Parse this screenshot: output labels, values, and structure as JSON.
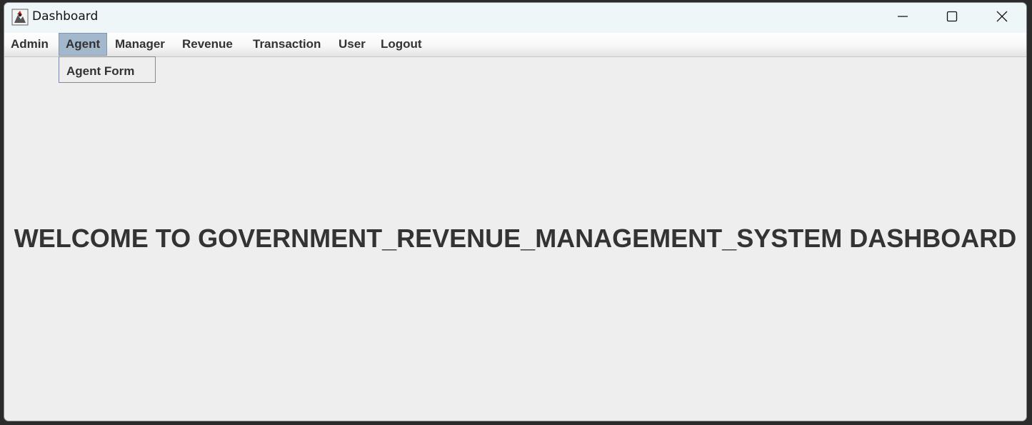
{
  "window": {
    "title": "Dashboard",
    "app_icon": "java-duke-icon",
    "controls": {
      "minimize_icon": "minimize-icon",
      "maximize_icon": "maximize-icon",
      "close_icon": "close-icon"
    }
  },
  "menubar": {
    "items": [
      {
        "label": "Admin"
      },
      {
        "label": "Agent",
        "active": true
      },
      {
        "label": "Manager"
      },
      {
        "label": "Revenue"
      },
      {
        "label": "Transaction"
      },
      {
        "label": "User"
      },
      {
        "label": "Logout"
      }
    ],
    "open_menu": {
      "parent": "Agent",
      "items": [
        {
          "label": "Agent Form"
        }
      ]
    }
  },
  "content": {
    "welcome_text": "WELCOME TO GOVERNMENT_REVENUE_MANAGEMENT_SYSTEM DASHBOARD"
  },
  "colors": {
    "titlebar_bg": "#eef6f8",
    "content_bg": "#eeeeee",
    "menu_active_bg": "#a3b8cc",
    "text": "#333333"
  }
}
